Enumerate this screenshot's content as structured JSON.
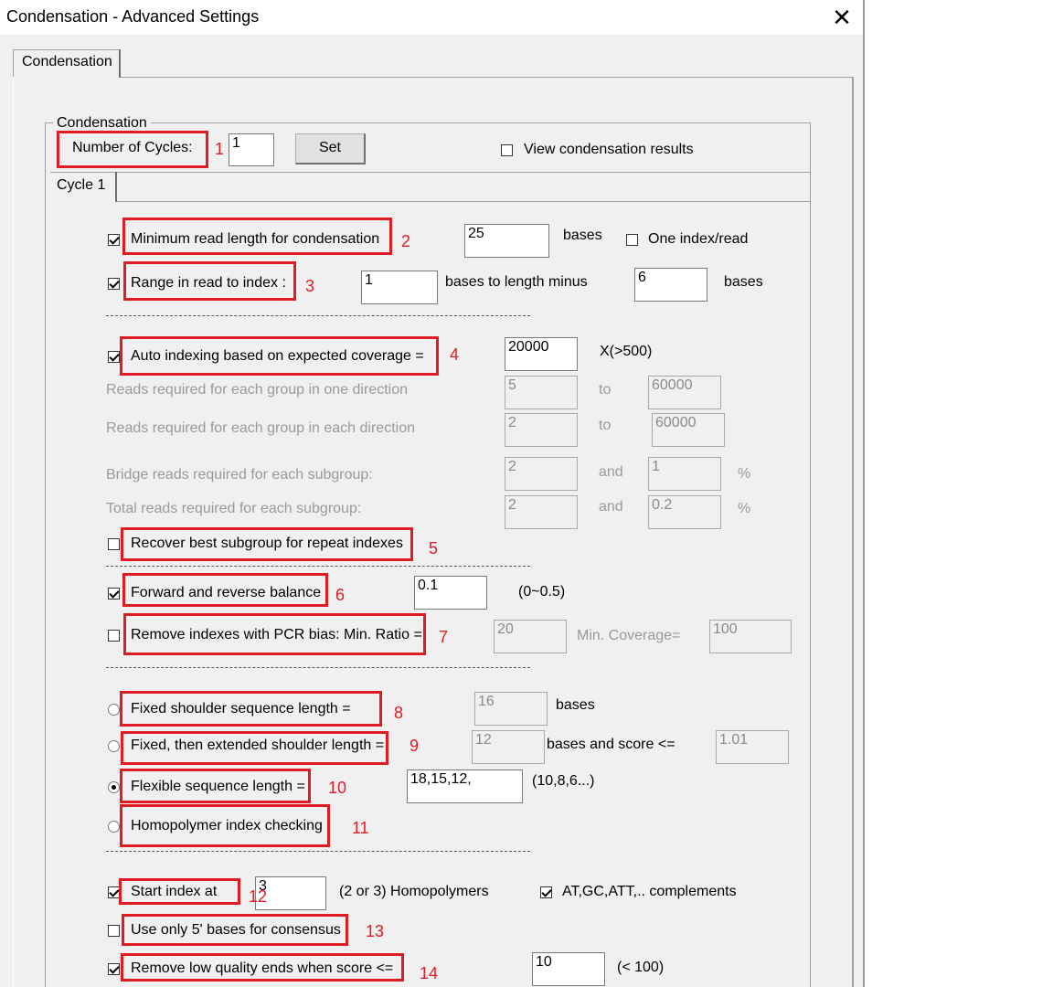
{
  "window": {
    "title": "Condensation - Advanced Settings"
  },
  "tabs": [
    "Condensation"
  ],
  "group_label": "Condensation",
  "cycles": {
    "label": "Number of Cycles:",
    "value": "1",
    "set_button": "Set",
    "view_label": "View condensation results",
    "view_checked": false
  },
  "cycle_tab": "Cycle 1",
  "rows": {
    "min_read": {
      "label": "Minimum read length for condensation",
      "checked": true,
      "value": "25",
      "unit": "bases",
      "one_index_label": "One index/read",
      "one_index_checked": false
    },
    "range": {
      "label": "Range in read to index :",
      "checked": true,
      "start": "1",
      "mid_text": "bases to length minus",
      "end": "6",
      "unit": "bases"
    },
    "auto": {
      "label": "Auto indexing based on expected coverage =",
      "checked": true,
      "value": "20000",
      "unit": "X(>500)"
    },
    "one_dir": {
      "label": "Reads required for each group in one direction",
      "v1": "5",
      "to": "to",
      "v2": "60000"
    },
    "each_dir": {
      "label": "Reads required for each group in each direction",
      "v1": "2",
      "to": "to",
      "v2": "60000"
    },
    "bridge": {
      "label": "Bridge reads required for each subgroup:",
      "v1": "2",
      "and": "and",
      "v2": "1",
      "pct": "%"
    },
    "total": {
      "label": "Total reads required for each subgroup:",
      "v1": "2",
      "and": "and",
      "v2": "0.2",
      "pct": "%"
    },
    "recover": {
      "label": "Recover best subgroup for repeat indexes",
      "checked": false
    },
    "balance": {
      "label": "Forward and reverse balance",
      "checked": true,
      "value": "0.1",
      "range": "(0~0.5)"
    },
    "pcr": {
      "label": "Remove indexes with PCR bias: Min. Ratio =",
      "checked": false,
      "value": "20",
      "cov_label": "Min. Coverage=",
      "cov_value": "100"
    },
    "fixed": {
      "label": "Fixed shoulder sequence length =",
      "selected": false,
      "value": "16",
      "unit": "bases"
    },
    "fixed_ext": {
      "label": "Fixed, then extended shoulder length =",
      "selected": false,
      "value": "12",
      "mid_text": "bases and score <=",
      "score": "1.01"
    },
    "flexible": {
      "label": "Flexible sequence length =",
      "selected": true,
      "value": "18,15,12,",
      "hint": "(10,8,6...)"
    },
    "homo": {
      "label": "Homopolymer index checking",
      "selected": false
    },
    "start": {
      "label": "Start index at",
      "checked": true,
      "value": "3",
      "hint": "(2 or 3) Homopolymers",
      "comp_label": "AT,GC,ATT,.. complements",
      "comp_checked": true
    },
    "five_prime": {
      "label": "Use only 5' bases for consensus",
      "checked": false
    },
    "low_q": {
      "label": "Remove low quality ends when score <=",
      "checked": true,
      "value": "10",
      "hint": "(< 100)"
    }
  },
  "annotations": [
    "1",
    "2",
    "3",
    "4",
    "5",
    "6",
    "7",
    "8",
    "9",
    "10",
    "11",
    "12",
    "13",
    "14"
  ],
  "colors": {
    "highlight": "#e11b22",
    "window_bg": "#f0f0f0"
  }
}
